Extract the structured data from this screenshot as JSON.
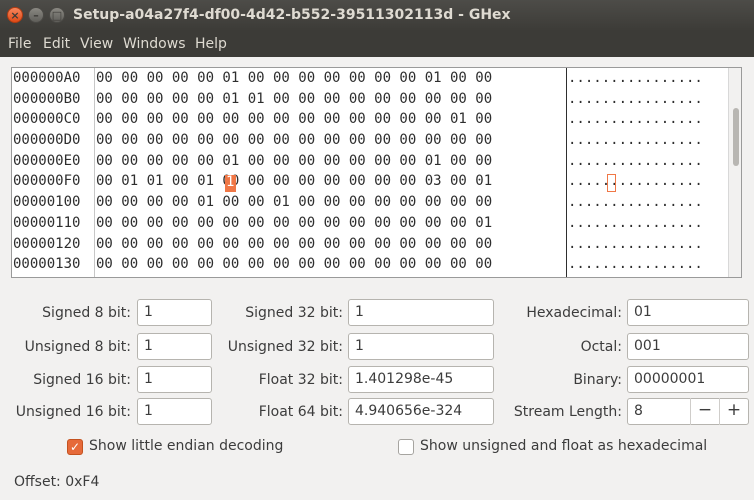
{
  "window": {
    "title": "Setup-a04a27f4-df00-4d42-b552-39511302113d - GHex",
    "close_glyph": "×",
    "min_glyph": "–",
    "max_glyph": "□"
  },
  "menu": [
    "File",
    "Edit",
    "View",
    "Windows",
    "Help"
  ],
  "hex": {
    "rows": [
      {
        "offset": "000000A0",
        "bytes": "00 00 00 00 00 01 00 00 00 00 00 00 00 01 00 00",
        "ascii": "................"
      },
      {
        "offset": "000000B0",
        "bytes": "00 00 00 00 00 01 01 00 00 00 00 00 00 00 00 00",
        "ascii": "................"
      },
      {
        "offset": "000000C0",
        "bytes": "00 00 00 00 00 00 00 00 00 00 00 00 00 00 01 00",
        "ascii": "................"
      },
      {
        "offset": "000000D0",
        "bytes": "00 00 00 00 00 00 00 00 00 00 00 00 00 00 00 00",
        "ascii": "................"
      },
      {
        "offset": "000000E0",
        "bytes": "00 00 00 00 00 01 00 00 00 00 00 00 00 01 00 00",
        "ascii": "................"
      },
      {
        "offset": "000000F0",
        "bytes": "00 01 01 00 01 00 00 00 00 00 00 00 00 03 00 01",
        "ascii": "................"
      },
      {
        "offset": "00000100",
        "bytes": "00 00 00 00 01 00 00 01 00 00 00 00 00 00 00 00",
        "ascii": "................"
      },
      {
        "offset": "00000110",
        "bytes": "00 00 00 00 00 00 00 00 00 00 00 00 00 00 00 01",
        "ascii": "................"
      },
      {
        "offset": "00000120",
        "bytes": "00 00 00 00 00 00 00 00 00 00 00 00 00 00 00 00",
        "ascii": "................"
      },
      {
        "offset": "00000130",
        "bytes": "00 00 00 00 00 00 00 00 00 00 00 00 00 00 00 00",
        "ascii": "................"
      }
    ],
    "cursor_value": "1",
    "cursor_color": "#f07746"
  },
  "fields": {
    "signed8": {
      "label": "Signed 8 bit:",
      "value": "1"
    },
    "unsigned8": {
      "label": "Unsigned 8 bit:",
      "value": "1"
    },
    "signed16": {
      "label": "Signed 16 bit:",
      "value": "1"
    },
    "unsigned16": {
      "label": "Unsigned 16 bit:",
      "value": "1"
    },
    "signed32": {
      "label": "Signed 32 bit:",
      "value": "1"
    },
    "unsigned32": {
      "label": "Unsigned 32 bit:",
      "value": "1"
    },
    "float32": {
      "label": "Float 32 bit:",
      "value": "1.401298e-45"
    },
    "float64": {
      "label": "Float 64 bit:",
      "value": "4.940656e-324"
    },
    "hex": {
      "label": "Hexadecimal:",
      "value": "01"
    },
    "octal": {
      "label": "Octal:",
      "value": "001"
    },
    "binary": {
      "label": "Binary:",
      "value": "00000001"
    },
    "stream": {
      "label": "Stream Length:",
      "value": "8",
      "minus": "−",
      "plus": "+"
    }
  },
  "options": {
    "little_endian": {
      "label": "Show little endian decoding",
      "checked": true,
      "check_glyph": "✓"
    },
    "hex_display": {
      "label": "Show unsigned and float as hexadecimal",
      "checked": false
    }
  },
  "status": {
    "offset_text": "Offset: 0xF4"
  },
  "accent": "#e66a3a"
}
